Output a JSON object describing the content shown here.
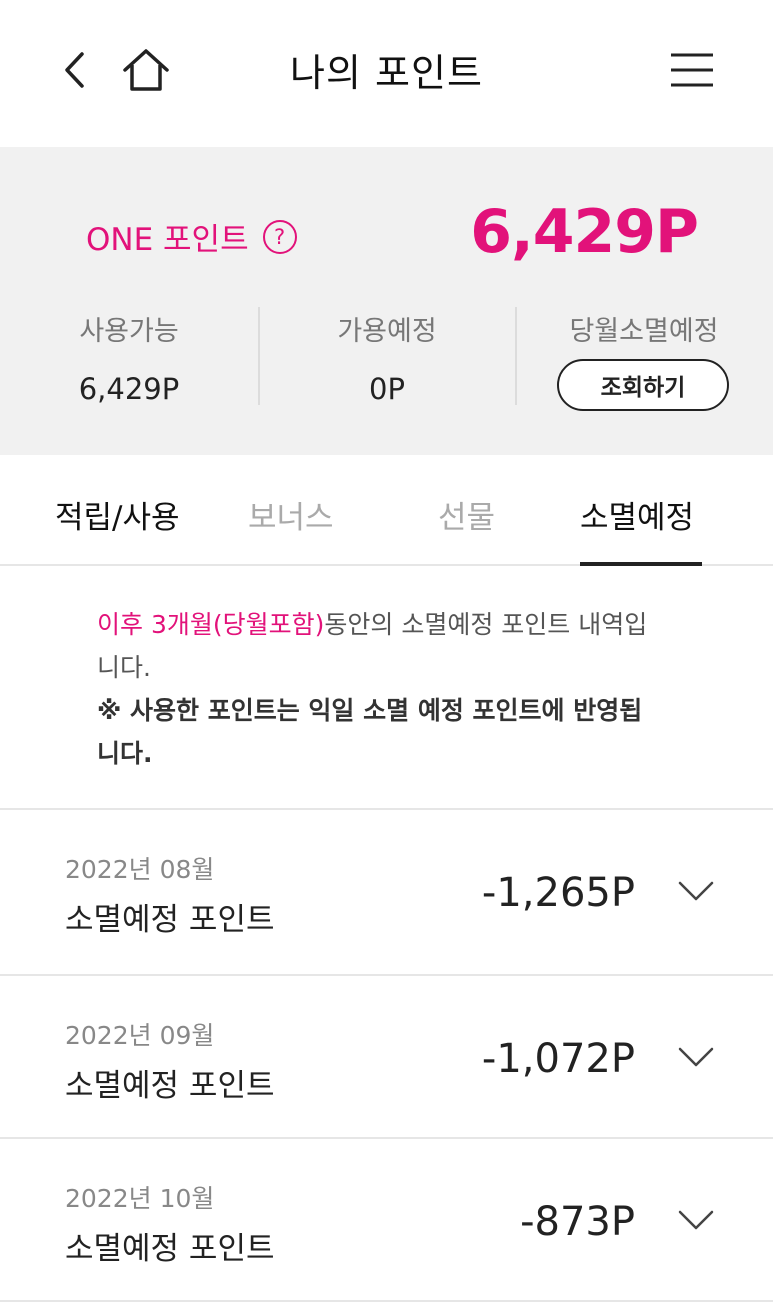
{
  "header": {
    "title": "나의 포인트"
  },
  "summary": {
    "one_label": "ONE 포인트",
    "help_symbol": "?",
    "total": "6,429P",
    "available_label": "사용가능",
    "available_value": "6,429P",
    "pending_label": "가용예정",
    "pending_value": "0P",
    "expiring_label": "당월소멸예정",
    "lookup_button": "조회하기"
  },
  "tabs": [
    {
      "label": "적립/사용"
    },
    {
      "label": "보너스"
    },
    {
      "label": "선물"
    },
    {
      "label": "소멸예정"
    }
  ],
  "notice": {
    "highlight": "이후 3개월(당월포함)",
    "text": "동안의 소멸예정 포인트 내역입니다.",
    "bold": "※ 사용한 포인트는 익일 소멸 예정 포인트에 반영됩니다."
  },
  "rows": [
    {
      "date": "2022년 08월",
      "label": "소멸예정 포인트",
      "amount": "-1,265P"
    },
    {
      "date": "2022년 09월",
      "label": "소멸예정 포인트",
      "amount": "-1,072P"
    },
    {
      "date": "2022년 10월",
      "label": "소멸예정 포인트",
      "amount": "-873P"
    }
  ],
  "colors": {
    "accent": "#e2127a",
    "summary_bg": "#f1f1f1"
  },
  "icons": {
    "back": "chevron-left-icon",
    "home": "home-icon",
    "menu": "hamburger-menu-icon",
    "help": "question-circle-icon",
    "expand": "chevron-down-icon"
  }
}
